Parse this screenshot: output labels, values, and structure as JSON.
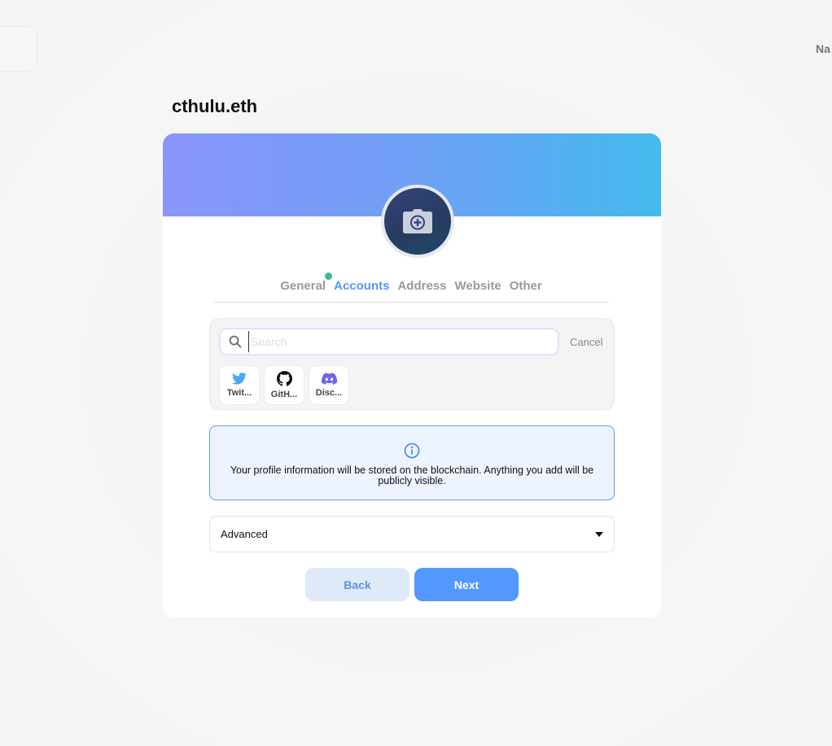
{
  "header": {
    "right_text": "Na"
  },
  "profile": {
    "name": "cthulu.eth"
  },
  "tabs": [
    {
      "label": "General",
      "active": false,
      "has_dot": true
    },
    {
      "label": "Accounts",
      "active": true,
      "has_dot": false
    },
    {
      "label": "Address",
      "active": false,
      "has_dot": false
    },
    {
      "label": "Website",
      "active": false,
      "has_dot": false
    },
    {
      "label": "Other",
      "active": false,
      "has_dot": false
    }
  ],
  "search": {
    "placeholder": "Search",
    "value": "",
    "cancel_label": "Cancel"
  },
  "accounts": [
    {
      "label": "Twit...",
      "icon": "twitter-icon",
      "color": "#4aa7f0"
    },
    {
      "label": "GitH...",
      "icon": "github-icon",
      "color": "#111111"
    },
    {
      "label": "Disc...",
      "icon": "discord-icon",
      "color": "#6f63e8"
    }
  ],
  "info": {
    "text": "Your profile information will be stored on the blockchain. Anything you add will be publicly visible.",
    "icon": "info-icon"
  },
  "advanced": {
    "label": "Advanced"
  },
  "buttons": {
    "back": "Back",
    "next": "Next"
  },
  "colors": {
    "accent": "#5298ff",
    "status_dot": "#3cb98a"
  }
}
